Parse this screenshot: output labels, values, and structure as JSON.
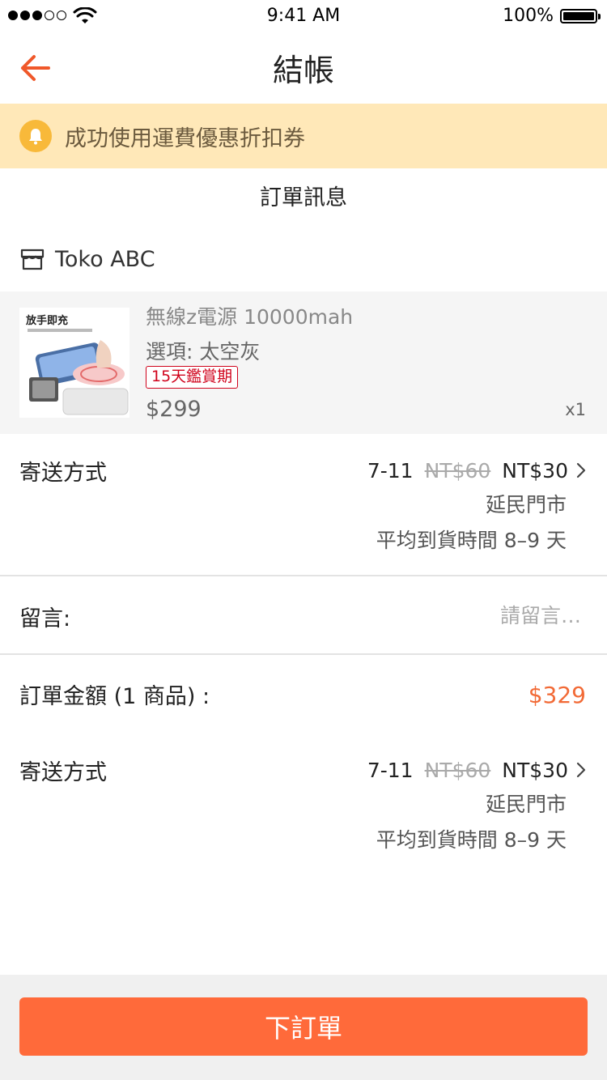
{
  "status_bar": {
    "time": "9:41 AM",
    "battery": "100%"
  },
  "header": {
    "title": "結帳"
  },
  "notice": {
    "text": "成功使用運費優惠折扣券"
  },
  "order_info": {
    "title": "訂單訊息"
  },
  "shop": {
    "name": "Toko ABC"
  },
  "product": {
    "name": "無線z電源 10000mah",
    "option": "選項: 太空灰",
    "badge": "15天鑑賞期",
    "price": "$299",
    "qty": "x1",
    "image_caption": "放手即充"
  },
  "shipping": {
    "label": "寄送方式",
    "carrier": "7-11",
    "old_price": "NT$60",
    "new_price": "NT$30",
    "store": "延民門市",
    "eta": "平均到貨時間 8–9 天"
  },
  "message": {
    "label": "留言:",
    "placeholder": "請留言…"
  },
  "total": {
    "label": "訂單金額 (1 商品) :",
    "value": "$329"
  },
  "shipping_summary": {
    "label": "寄送方式",
    "carrier": "7-11",
    "old_price": "NT$60",
    "new_price": "NT$30",
    "store": "延民門市",
    "eta": "平均到貨時間 8–9 天"
  },
  "footer": {
    "submit_label": "下訂單"
  },
  "colors": {
    "accent": "#ff6a3a",
    "price_accent": "#f26a36",
    "notice_bg": "#ffe8b8",
    "badge": "#d0021b"
  },
  "icons": [
    "back-arrow-icon",
    "bell-icon",
    "store-icon",
    "chevron-right-icon",
    "wifi-icon",
    "battery-icon"
  ]
}
